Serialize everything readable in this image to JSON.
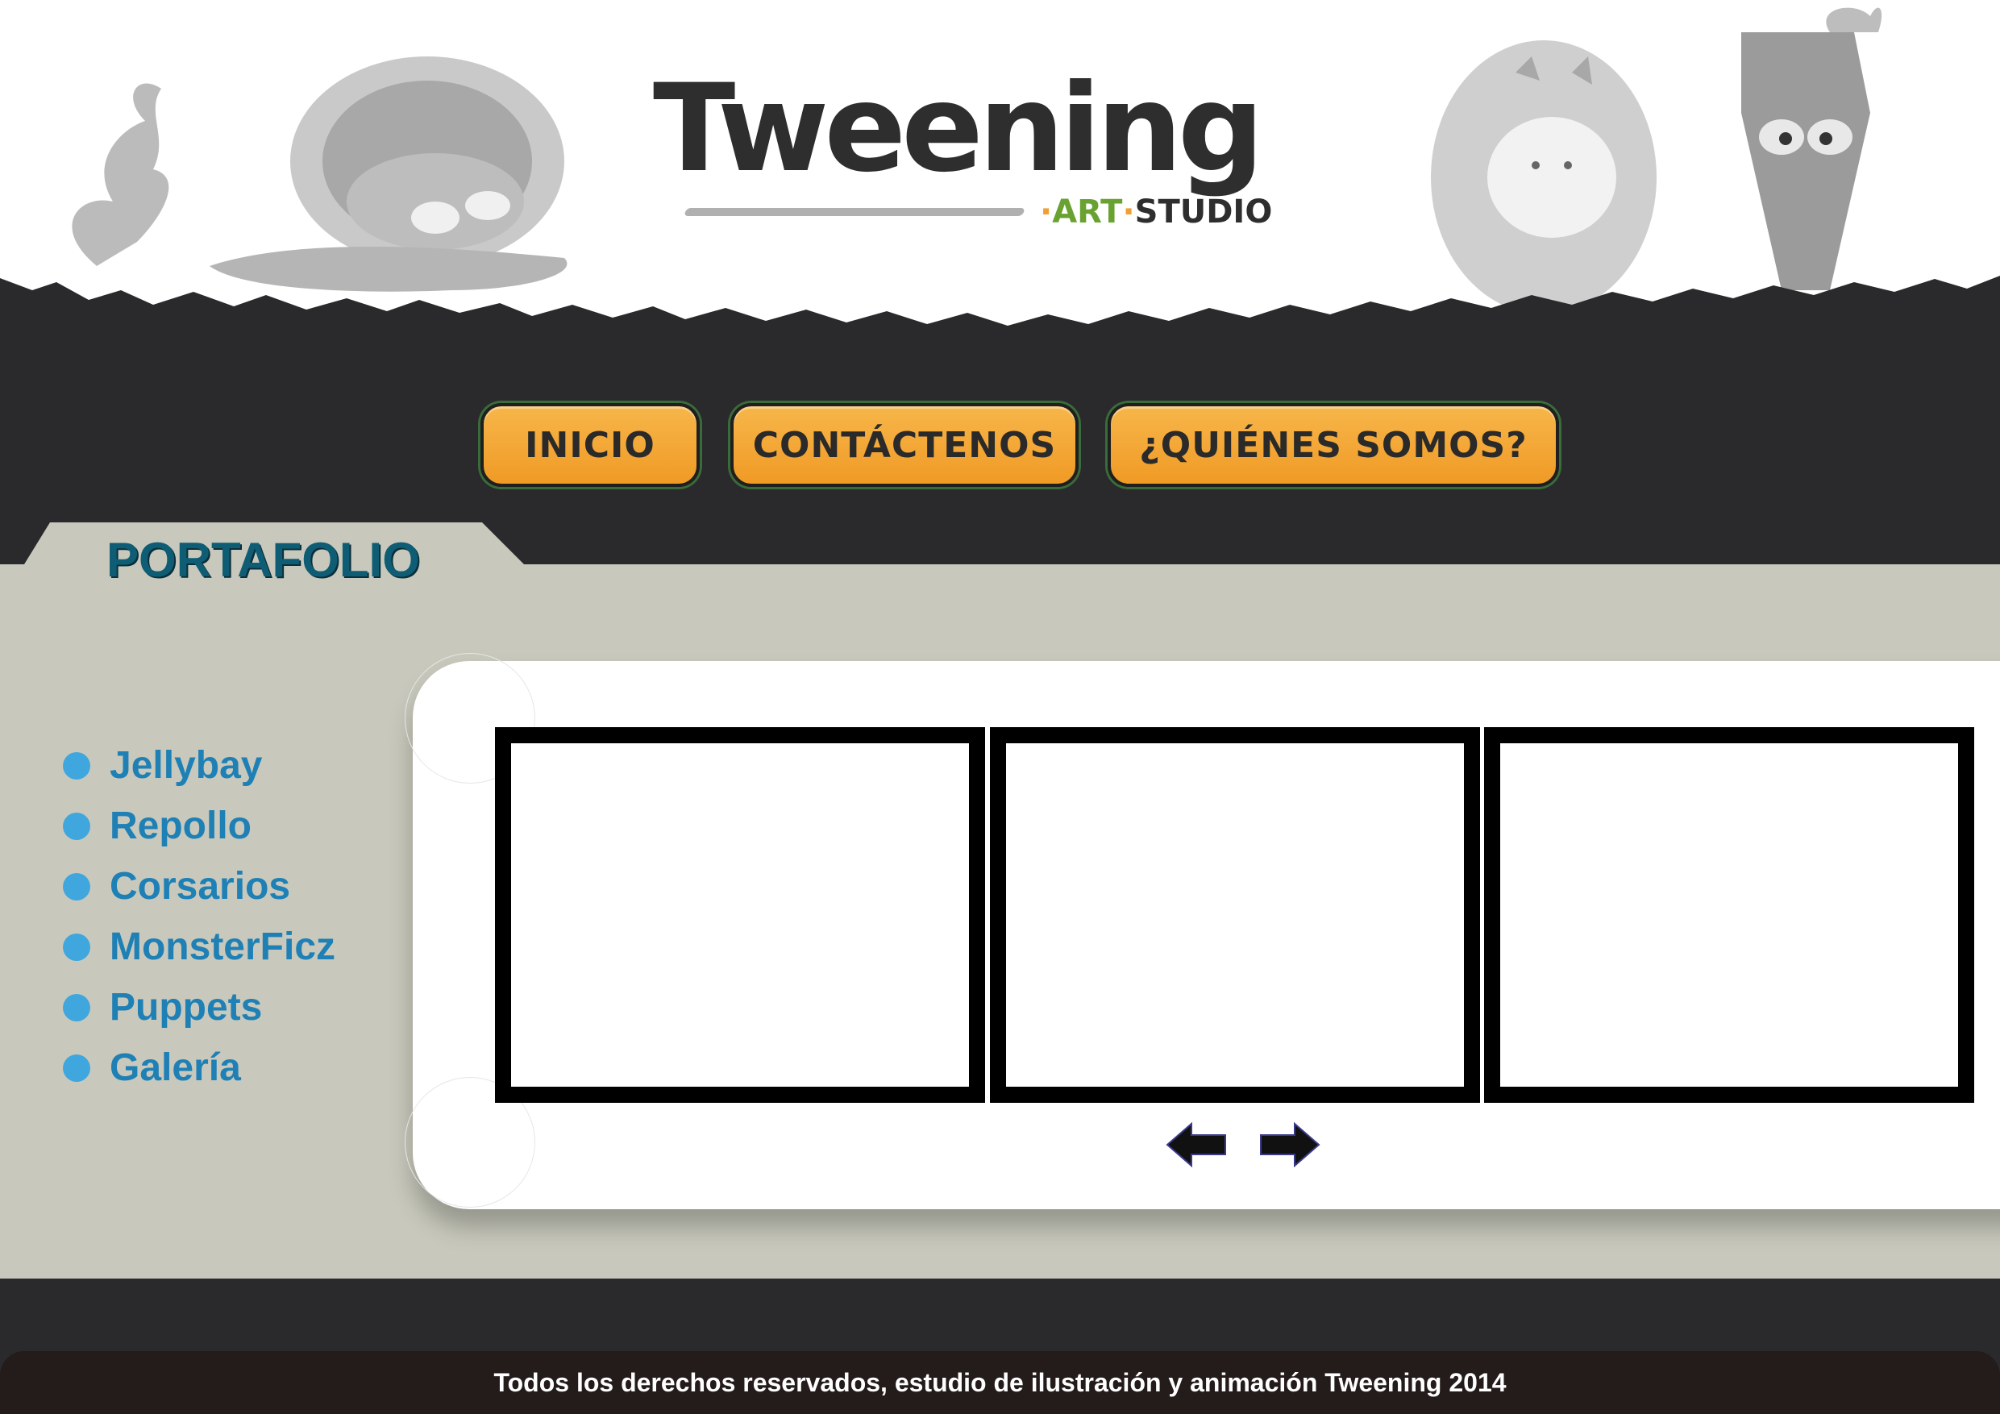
{
  "brand": {
    "logo_text": "Tweening",
    "logo_sub_art": "ART",
    "logo_sub_studio": "STUDIO",
    "colors": {
      "orange": "#f0a030",
      "green": "#6aa232",
      "dark": "#2a2a2c",
      "teal": "#0f5d74",
      "blue": "#1f80b5"
    }
  },
  "nav": {
    "items": [
      {
        "label": "INICIO"
      },
      {
        "label": "CONTÁCTENOS"
      },
      {
        "label": "¿QUIÉNES SOMOS?"
      }
    ]
  },
  "portfolio": {
    "title": "PORTAFOLIO",
    "items": [
      {
        "label": "Jellybay"
      },
      {
        "label": "Repollo"
      },
      {
        "label": "Corsarios"
      },
      {
        "label": "MonsterFicz"
      },
      {
        "label": "Puppets"
      },
      {
        "label": "Galería"
      }
    ],
    "icons": {
      "prev": "arrow-left-icon",
      "next": "arrow-right-icon",
      "bullet": "dot-icon"
    }
  },
  "footer": {
    "text": "Todos los derechos reservados, estudio de ilustración y animación Tweening 2014"
  }
}
